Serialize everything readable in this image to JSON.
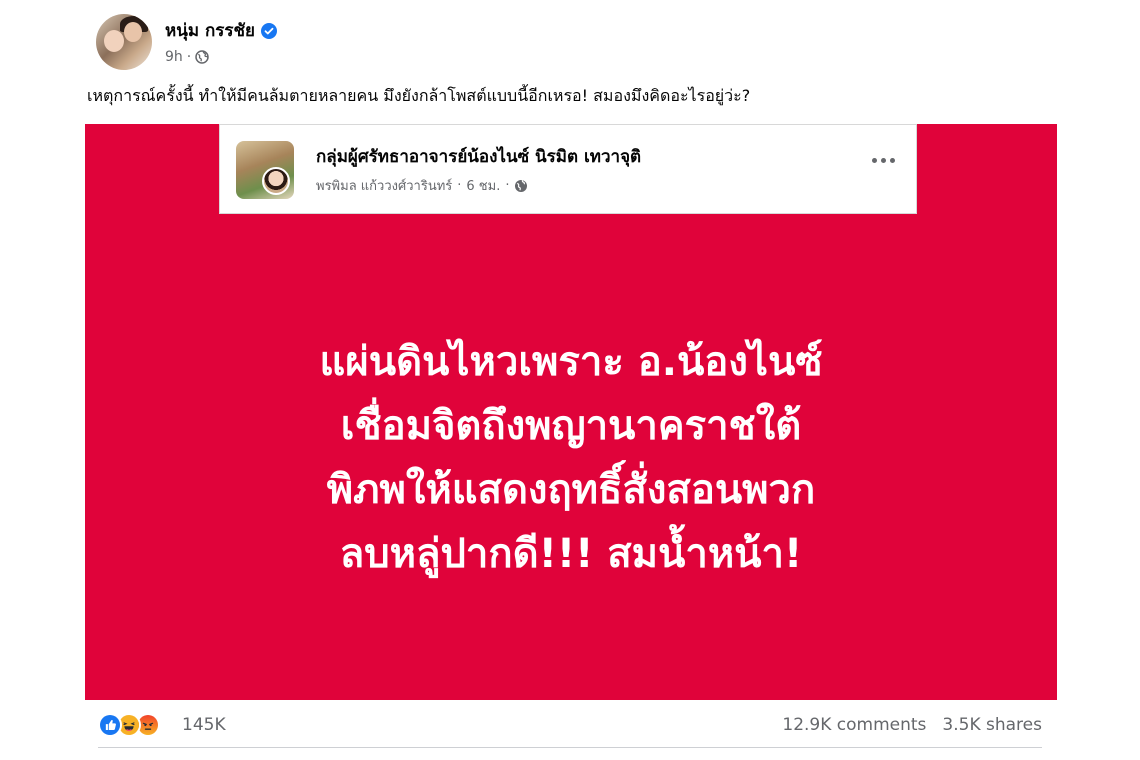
{
  "post": {
    "author_name": "หนุ่ม กรรชัย",
    "time": "9h",
    "meta_separator": "·",
    "caption": "เหตุการณ์ครั้งนี้ ทำให้มีคนล้มตายหลายคน มึงยังกล้าโพสต์แบบนี้อีกเหรอ! สมองมึงคิดอะไรอยู่ว่ะ?"
  },
  "embedded_post": {
    "group_name": "กลุ่มผู้ศรัทธาอาจารย์น้องไนซ์ นิรมิต เทวาจุติ",
    "poster": "พรพิมล แก้ววงศ์วารินทร์",
    "separator": "·",
    "time": "6 ชม.",
    "headline_lines": [
      "แผ่นดินไหวเพราะ อ.น้องไนซ์",
      "เชื่อมจิตถึงพญานาคราชใต้",
      "พิภพให้แสดงฤทธิ์สั่งสอนพวก",
      "ลบหลู่ปากดี!!! สมน้ำหน้า!"
    ]
  },
  "footer": {
    "reaction_count": "145K",
    "comments": "12.9K comments",
    "shares": "3.5K shares"
  },
  "icons": {
    "verified": "verified-badge-icon",
    "globe": "globe-icon",
    "more": "more-dots-icon",
    "reactions": [
      "like-icon",
      "haha-icon",
      "angry-icon"
    ]
  },
  "colors": {
    "post_background": "#e0033a",
    "verified_blue": "#1877f2",
    "secondary_text": "#65676b"
  }
}
